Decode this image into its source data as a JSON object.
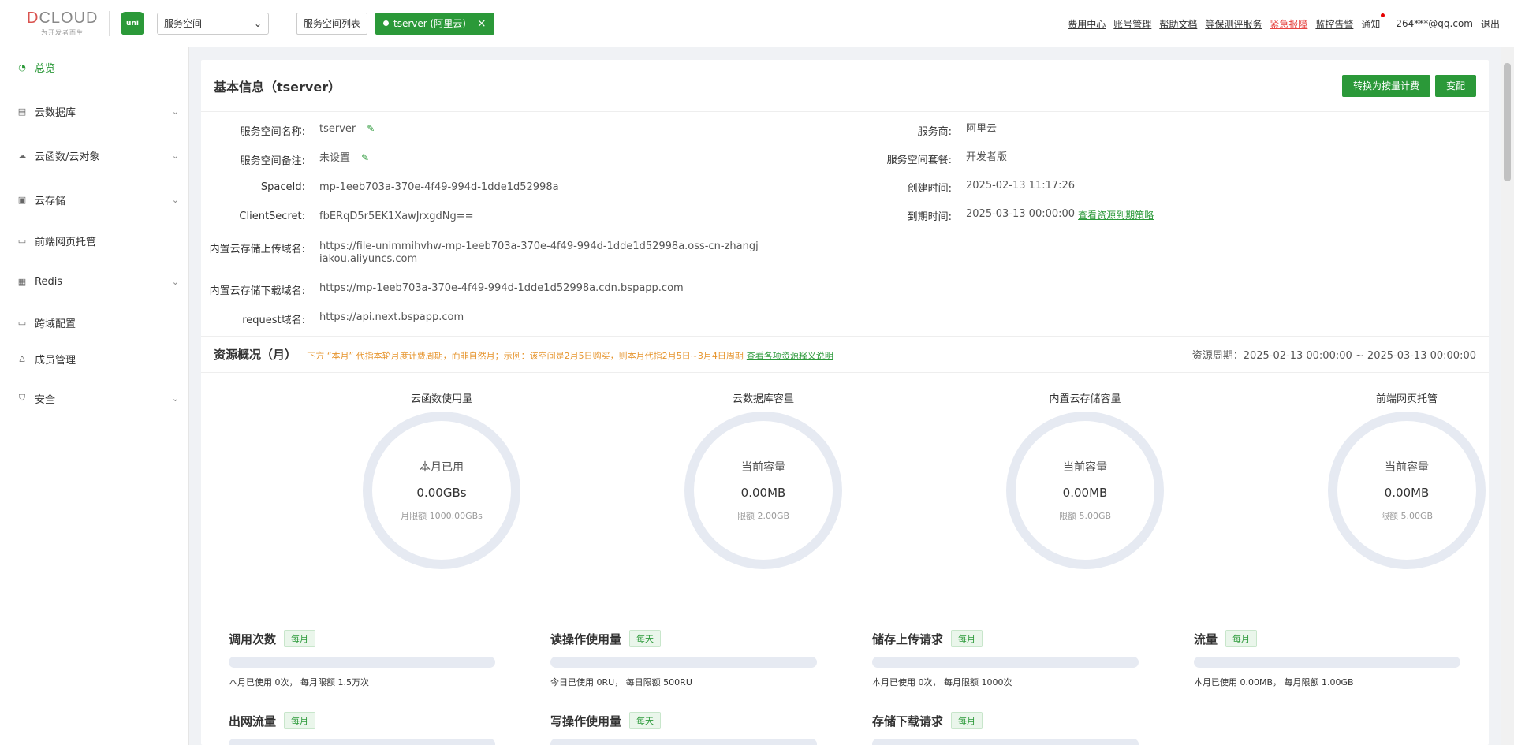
{
  "header": {
    "logo_text": "DCLOUD",
    "logo_sub": "为开发者而生",
    "uni_logo": "uni",
    "space_select": "服务空间",
    "space_list_label": "服务空间列表",
    "active_space_tab": "tserver (阿里云)",
    "links": [
      "费用中心",
      "账号管理",
      "帮助文档",
      "等保测评服务",
      "紧急报障",
      "监控告警"
    ],
    "notify_label": "通知",
    "user": "264***@qq.com",
    "logout": "退出"
  },
  "sidebar": {
    "items": [
      {
        "label": "总览",
        "icon": "dashboard-icon",
        "active": true,
        "expandable": false
      },
      {
        "label": "云数据库",
        "icon": "database-icon",
        "active": false,
        "expandable": true
      },
      {
        "label": "云函数/云对象",
        "icon": "cloud-icon",
        "active": false,
        "expandable": true
      },
      {
        "label": "云存储",
        "icon": "storage-icon",
        "active": false,
        "expandable": true
      },
      {
        "label": "前端网页托管",
        "icon": "web-hosting-icon",
        "active": false,
        "expandable": false
      },
      {
        "label": "Redis",
        "icon": "redis-icon",
        "active": false,
        "expandable": true
      },
      {
        "label": "跨域配置",
        "icon": "cors-icon",
        "active": false,
        "expandable": false
      },
      {
        "label": "成员管理",
        "icon": "members-icon",
        "active": false,
        "expandable": false
      },
      {
        "label": "安全",
        "icon": "shield-icon",
        "active": false,
        "expandable": true
      }
    ]
  },
  "basic_info": {
    "title": "基本信息（tserver）",
    "buttons": {
      "switch_billing": "转换为按量计费",
      "change_plan": "变配"
    },
    "left": [
      {
        "label": "服务空间名称:",
        "value": "tserver",
        "editable": true
      },
      {
        "label": "服务空间备注:",
        "value": "未设置",
        "editable": true
      },
      {
        "label": "SpaceId:",
        "value": "mp-1eeb703a-370e-4f49-994d-1dde1d52998a",
        "editable": false
      },
      {
        "label": "ClientSecret:",
        "value": "fbERqD5r5EK1XawJrxgdNg==",
        "editable": false
      },
      {
        "label": "内置云存储上传域名:",
        "value": "https://file-unimmihvhw-mp-1eeb703a-370e-4f49-994d-1dde1d52998a.oss-cn-zhangjiakou.aliyuncs.com",
        "editable": false
      },
      {
        "label": "内置云存储下载域名:",
        "value": "https://mp-1eeb703a-370e-4f49-994d-1dde1d52998a.cdn.bspapp.com",
        "editable": false
      },
      {
        "label": "request域名:",
        "value": "https://api.next.bspapp.com",
        "editable": false
      }
    ],
    "right": [
      {
        "label": "服务商:",
        "value": "阿里云"
      },
      {
        "label": "服务空间套餐:",
        "value": "开发者版"
      },
      {
        "label": "创建时间:",
        "value": "2025-02-13 11:17:26"
      },
      {
        "label": "到期时间:",
        "value": "2025-03-13 00:00:00",
        "link": "查看资源到期策略"
      }
    ]
  },
  "resources": {
    "title": "资源概况（月）",
    "note": "下方 “本月” 代指本轮月度计费周期，而非自然月；示例：该空间是2月5日购买，则本月代指2月5日~3月4日周期",
    "note_link": "查看各项资源释义说明",
    "period": "资源周期：2025-02-13 00:00:00 ~ 2025-03-13 00:00:00",
    "gauges": [
      {
        "title": "云函数使用量",
        "label": "本月已用",
        "value": "0.00GBs",
        "limit": "月限额 1000.00GBs",
        "fraction": 0
      },
      {
        "title": "云数据库容量",
        "label": "当前容量",
        "value": "0.00MB",
        "limit": "限额 2.00GB",
        "fraction": 0
      },
      {
        "title": "内置云存储容量",
        "label": "当前容量",
        "value": "0.00MB",
        "limit": "限额 5.00GB",
        "fraction": 0
      },
      {
        "title": "前端网页托管",
        "label": "当前容量",
        "value": "0.00MB",
        "limit": "限额 5.00GB",
        "fraction": 0
      }
    ],
    "usage": [
      {
        "title": "调用次数",
        "tag": "每月",
        "text": "本月已使用 0次， 每月限额 1.5万次",
        "fraction": 0
      },
      {
        "title": "读操作使用量",
        "tag": "每天",
        "text": "今日已使用 0RU， 每日限额 500RU",
        "fraction": 0
      },
      {
        "title": "储存上传请求",
        "tag": "每月",
        "text": "本月已使用 0次， 每月限额 1000次",
        "fraction": 0
      },
      {
        "title": "流量",
        "tag": "每月",
        "text": "本月已使用 0.00MB， 每月限额 1.00GB",
        "fraction": 0
      },
      {
        "title": "出网流量",
        "tag": "每月",
        "text": "",
        "fraction": 0
      },
      {
        "title": "写操作使用量",
        "tag": "每天",
        "text": "",
        "fraction": 0
      },
      {
        "title": "存储下载请求",
        "tag": "每月",
        "text": "",
        "fraction": 0
      }
    ]
  }
}
